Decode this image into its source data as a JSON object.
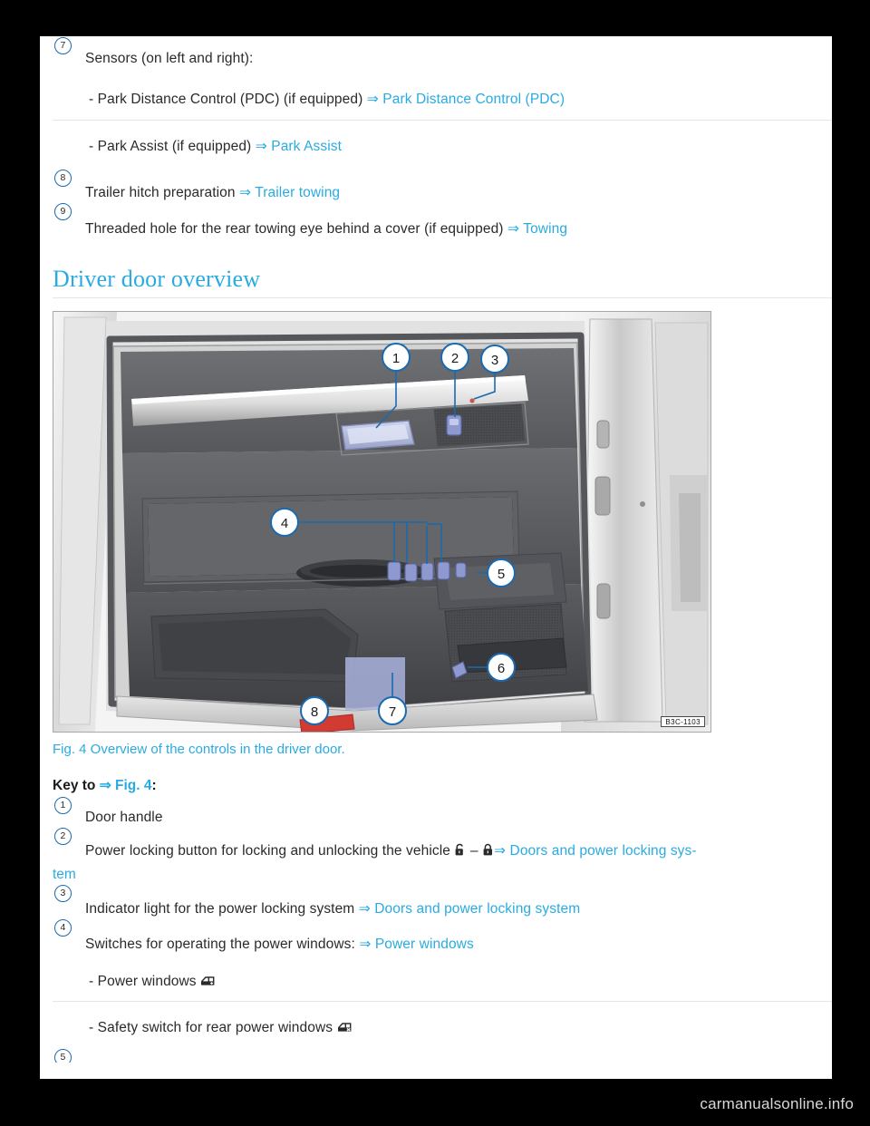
{
  "top_list": [
    {
      "num": "7",
      "text": "Sensors (on left and right):",
      "link": "",
      "arrow": ""
    }
  ],
  "top_sublist": [
    {
      "text": "- Park Distance Control (PDC) (if equipped)",
      "arrow": "⇒",
      "link": "Park Distance Control (PDC)"
    },
    {
      "text": "- Park Assist (if equipped)",
      "arrow": "⇒",
      "link": "Park Assist"
    }
  ],
  "items_89": [
    {
      "num": "8",
      "text": "Trailer hitch preparation",
      "arrow": "⇒",
      "link": "Trailer towing"
    },
    {
      "num": "9",
      "text": "Threaded hole for the rear towing eye behind a cover (if equipped)",
      "arrow": "⇒",
      "link": "Towing"
    }
  ],
  "section": {
    "title": "Driver door overview"
  },
  "figure": {
    "id_label": "B3C-1103",
    "caption": "Fig. 4 Overview of the controls in the driver door.",
    "callouts": [
      "1",
      "2",
      "3",
      "4",
      "5",
      "6",
      "7",
      "8"
    ]
  },
  "key": {
    "label_prefix": "Key to",
    "arrow": "⇒",
    "fig_link": "Fig. 4",
    "colon": ":"
  },
  "key_items": [
    {
      "num": "1",
      "text": "Door handle",
      "arrow": "",
      "link": "",
      "tail": ""
    },
    {
      "num": "2",
      "text": "Power locking button for locking and unlocking the vehicle",
      "icons": [
        "lock-open-icon",
        "dash",
        "lock-closed-icon"
      ],
      "arrow": "⇒",
      "link": "Doors and power locking sys-",
      "link2": "tem"
    },
    {
      "num": "3",
      "text": "Indicator light for the power locking system",
      "arrow": "⇒",
      "link": "Doors and power locking system"
    },
    {
      "num": "4",
      "text": "Switches for operating the power windows:",
      "arrow": "⇒",
      "link": "Power windows"
    }
  ],
  "key_sublist": [
    {
      "text": "- Power windows",
      "icon": "power-window-icon"
    },
    {
      "text": "- Safety switch for rear power windows",
      "icon": "power-window-safety-icon"
    }
  ],
  "cut_item": {
    "num": "5"
  },
  "watermark": "carmanualsonline.info",
  "colors": {
    "link": "#29ABE2",
    "heading": "#29ABE2",
    "badge_border": "#1a6ab0",
    "body_text": "#2a2a2a",
    "page_bg": "#ffffff",
    "canvas_bg": "#000000",
    "rule": "#e3e6e8"
  }
}
